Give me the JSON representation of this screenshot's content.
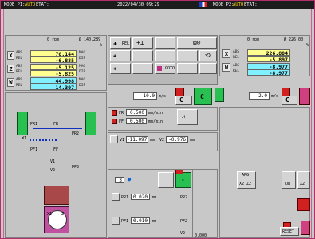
{
  "status_bar": {
    "left_mode": "MODE P1:",
    "left_mode_val": "AUTO",
    "left_state": "ETAT:",
    "datetime": "2022/04/30 09:29",
    "right_mode": "MODE P2:",
    "right_mode_val": "AUTO",
    "right_state": "ETAT:"
  },
  "left_spindle": {
    "rpm": "0 rpm",
    "diam": "Ø 140.289",
    "pct": "%",
    "axes": [
      {
        "axis": "X",
        "abs_label": "ABS",
        "abs_val": "70.144",
        "rel_label": "REL",
        "rel_val": "-6.885",
        "cyan": false
      },
      {
        "axis": "Z",
        "abs_label": "ABS",
        "abs_val": "-5.125",
        "rel_label": "REL",
        "rel_val": "-5.825",
        "cyan": false
      },
      {
        "axis": "W",
        "abs_label": "ABS",
        "abs_val": "44.998",
        "rel_label": "REL",
        "rel_val": "14.307",
        "cyan": true
      }
    ],
    "side_small": [
      "MAC",
      "DIF",
      "MAC",
      "DIF",
      "MAC",
      "DIF"
    ]
  },
  "right_spindle": {
    "rpm": "0 rpm",
    "diam": "Ø 226.00",
    "pct": "%",
    "axes": [
      {
        "axis": "X",
        "abs_label": "ABS",
        "abs_val": "226.804",
        "rel_label": "REL",
        "rel_val": "-5.897",
        "cyan": false
      },
      {
        "axis": "W",
        "abs_label": "ABS",
        "abs_val": "-8.977",
        "rel_label": "REL",
        "rel_val": "-8.977",
        "cyan": true
      }
    ]
  },
  "center_tools": {
    "rel_label": "REL",
    "buttons": [
      "REL",
      "+",
      "",
      "",
      "",
      "GOTO"
    ]
  },
  "middle": {
    "feed_left": "10.0",
    "feed_left_unit": "m/s",
    "feed_right": "2.0",
    "feed_right_unit": "m/s",
    "fr_label": "FR",
    "fr_val": "0.500",
    "fr_unit": "mm/min",
    "ff_label": "FF",
    "ff_val": "0.500",
    "ff_unit": "mm/min",
    "v1_label": "V1",
    "v1_val": "-11.097",
    "v1_unit": "mm",
    "v2_label": "V2",
    "v2_val": "-0.976",
    "v2_unit": "mm",
    "pr1_label": "PR1",
    "pr1_val": "0.020",
    "pr1_unit": "mm",
    "pr2_label": "PR2",
    "pf1_label": "PF1",
    "pf1_val": "0.010",
    "pf1_unit": "mm",
    "pf2_label": "PF2",
    "v2b_label": "V2",
    "counter": "3",
    "bottom_val": "0.000"
  },
  "diagram": {
    "pr1": "PR1",
    "fr": "FR",
    "pr2": "PR2",
    "w1": "W1",
    "pf1": "PF1",
    "ff": "FF",
    "pf2": "PF2",
    "v1": "V1",
    "v2": "V2",
    "x1": "X1",
    "z_label": "Z"
  },
  "right_side": {
    "apg_label": "APG",
    "x2_z2": "X2 Z2",
    "uw": "UW",
    "x2": "X2",
    "reset": "RESET"
  },
  "colors": {
    "border_magenta": "#b0306a",
    "yellow_field": "#ffff90",
    "cyan_field": "#80f0ff",
    "red": "#d02020",
    "green": "#28c050"
  }
}
